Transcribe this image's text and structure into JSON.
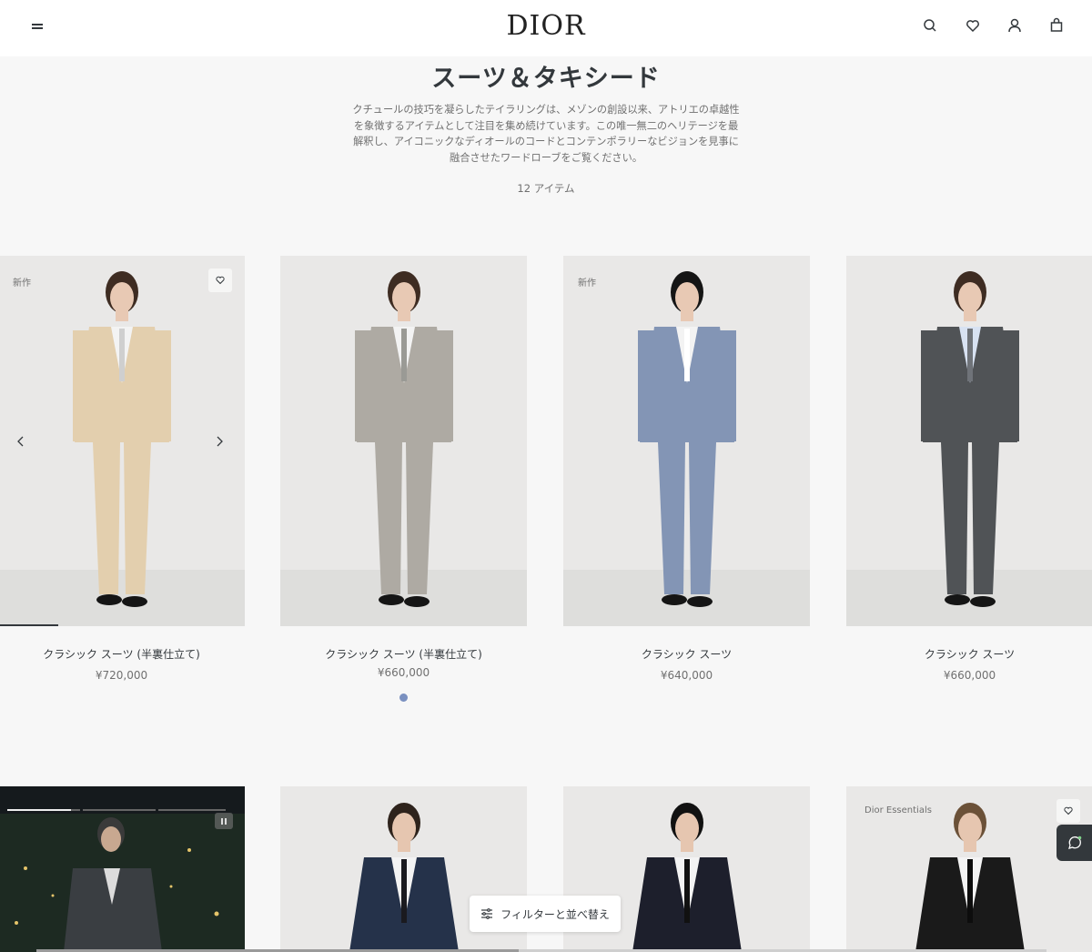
{
  "header": {
    "logo": "DIOR",
    "menu_icon": "hamburger-icon",
    "icons": [
      "search-icon",
      "heart-icon",
      "user-icon",
      "bag-icon"
    ]
  },
  "intro": {
    "title": "スーツ＆タキシード",
    "description_lines": [
      "クチュールの技巧を凝らしたテイラリングは、メゾンの創設以来、アトリエの卓越性",
      "を象徴するアイテムとして注目を集め続けています。この唯一無二のヘリテージを最",
      "解釈し、アイコニックなディオールのコードとコンテンポラリーなビジョンを見事に",
      "融合させたワードローブをご覧ください。"
    ],
    "item_count": "12 アイテム"
  },
  "products": [
    {
      "badge": "新作",
      "name": "クラシック スーツ (半裏仕立て)",
      "price": "¥720,000",
      "suit_color": "#e3cfae",
      "tie_color": "#cfcfcf"
    },
    {
      "badge": "",
      "name": "クラシック スーツ (半裏仕立て)",
      "price": "¥660,000",
      "suit_color": "#aeaaa3",
      "tie_color": "#9a9a95"
    },
    {
      "badge": "新作",
      "name": "クラシック スーツ",
      "price": "¥640,000",
      "suit_color": "#8395b5",
      "tie_color": "#ffffff"
    },
    {
      "badge": "",
      "name": "クラシック スーツ",
      "price": "¥660,000",
      "suit_color": "#505356",
      "tie_color": "#6f7379"
    }
  ],
  "row2": [
    {
      "type": "video",
      "badge": ""
    },
    {
      "type": "product",
      "badge": "",
      "suit_color": "#25324a"
    },
    {
      "type": "product",
      "badge": "",
      "suit_color": "#1d1f2c"
    },
    {
      "type": "product",
      "badge": "Dior Essentials",
      "suit_color": "#1a1a1a"
    }
  ],
  "filter": {
    "label": "フィルターと並べ替え",
    "icon": "sliders-icon"
  },
  "chat": {
    "icon": "chat-icon"
  },
  "colors": {
    "background": "#f7f7f7",
    "text": "#33383c",
    "muted": "#707070",
    "dot": "#7a90c0"
  }
}
